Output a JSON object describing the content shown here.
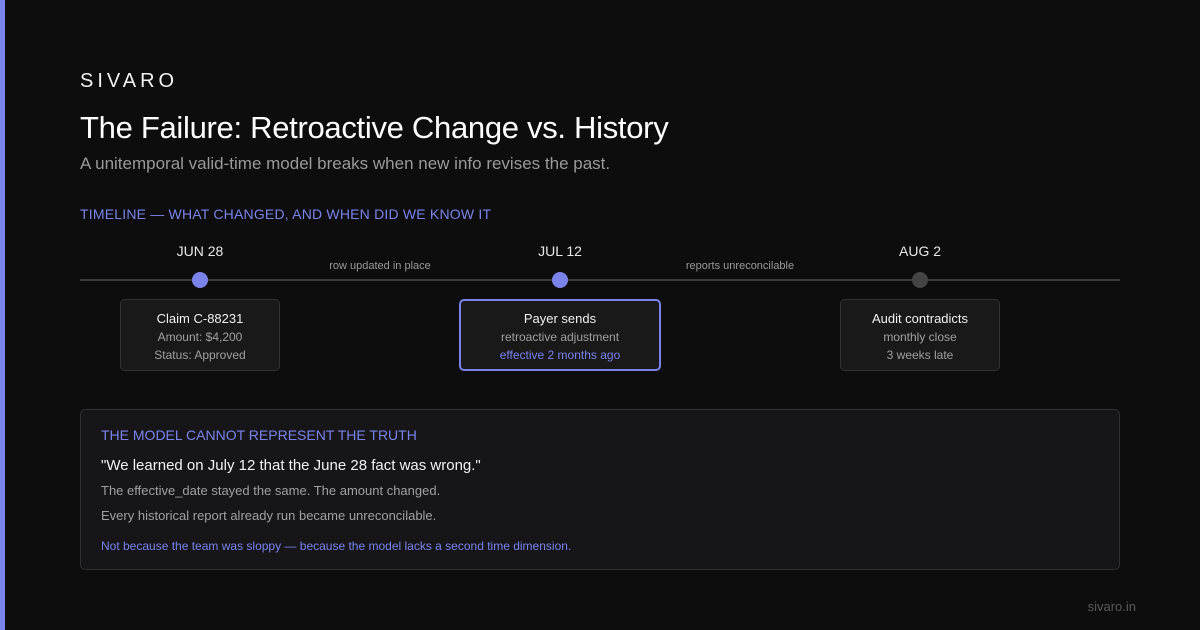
{
  "brand": "SIVARO",
  "title": "The Failure: Retroactive Change vs. History",
  "subtitle": "A unitemporal valid-time model breaks when new info revises the past.",
  "timeline": {
    "label": "TIMELINE — WHAT CHANGED, AND WHEN DID WE KNOW IT",
    "events": [
      {
        "date": "JUN 28",
        "card_title": "Claim C-88231",
        "card_line1": "Amount: $4,200",
        "card_line2": "Status: Approved"
      },
      {
        "date": "JUL 12",
        "card_title": "Payer sends",
        "card_line1": "retroactive adjustment",
        "card_line2": "effective 2 months ago"
      },
      {
        "date": "AUG 2",
        "card_title": "Audit contradicts",
        "card_line1": "monthly close",
        "card_line2": "3 weeks late"
      }
    ],
    "between": [
      "row updated in place",
      "reports unreconcilable"
    ]
  },
  "panel": {
    "label": "THE MODEL CANNOT REPRESENT THE TRUTH",
    "quote": "\"We learned on July 12 that the June 28 fact was wrong.\"",
    "line1": "The effective_date stayed the same. The amount changed.",
    "line2": "Every historical report already run became unreconcilable.",
    "note": "Not because the team was sloppy — because the model lacks a second time dimension."
  },
  "footer": "sivaro.in",
  "colors": {
    "accent": "#7b83eb",
    "background": "#0d0d0d",
    "muted_dot": "#444444"
  }
}
